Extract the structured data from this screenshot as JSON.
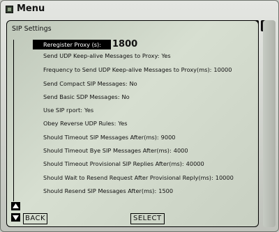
{
  "window": {
    "title": "Menu",
    "help_glyph": "?",
    "min_glyph": "_",
    "close_glyph": "x"
  },
  "panel": {
    "section_title": "SIP Settings"
  },
  "items": [
    {
      "label": "Reregister Proxy (s):",
      "value": "1800"
    },
    {
      "label": "Send UDP Keep-alive Messages to Proxy:",
      "value": "Yes"
    },
    {
      "label": "Frequency to Send UDP Keep-alive Messages to Proxy(ms):",
      "value": "10000"
    },
    {
      "label": "Send Compact SIP Messages:",
      "value": "No"
    },
    {
      "label": "Send Basic SDP Messages:",
      "value": "No"
    },
    {
      "label": "Use SIP rport:",
      "value": "Yes"
    },
    {
      "label": "Obey Reverse UDP Rules:",
      "value": "Yes"
    },
    {
      "label": "Should Timeout SIP Messages After(ms):",
      "value": "9000"
    },
    {
      "label": "Should Timeout Bye SIP Messages After(ms):",
      "value": "4000"
    },
    {
      "label": "Should Timeout Provisional SIP Replies After(ms):",
      "value": "40000"
    },
    {
      "label": "Should Wait to Resend Request After Provisional Reply(ms):",
      "value": "10000"
    },
    {
      "label": "Should Resend SIP Messages After(ms):",
      "value": "1500"
    }
  ],
  "softkeys": {
    "back": "BACK",
    "select": "SELECT"
  },
  "icons": {
    "app": "app-icon",
    "up": "arrow-up-icon",
    "down": "arrow-down-icon"
  }
}
